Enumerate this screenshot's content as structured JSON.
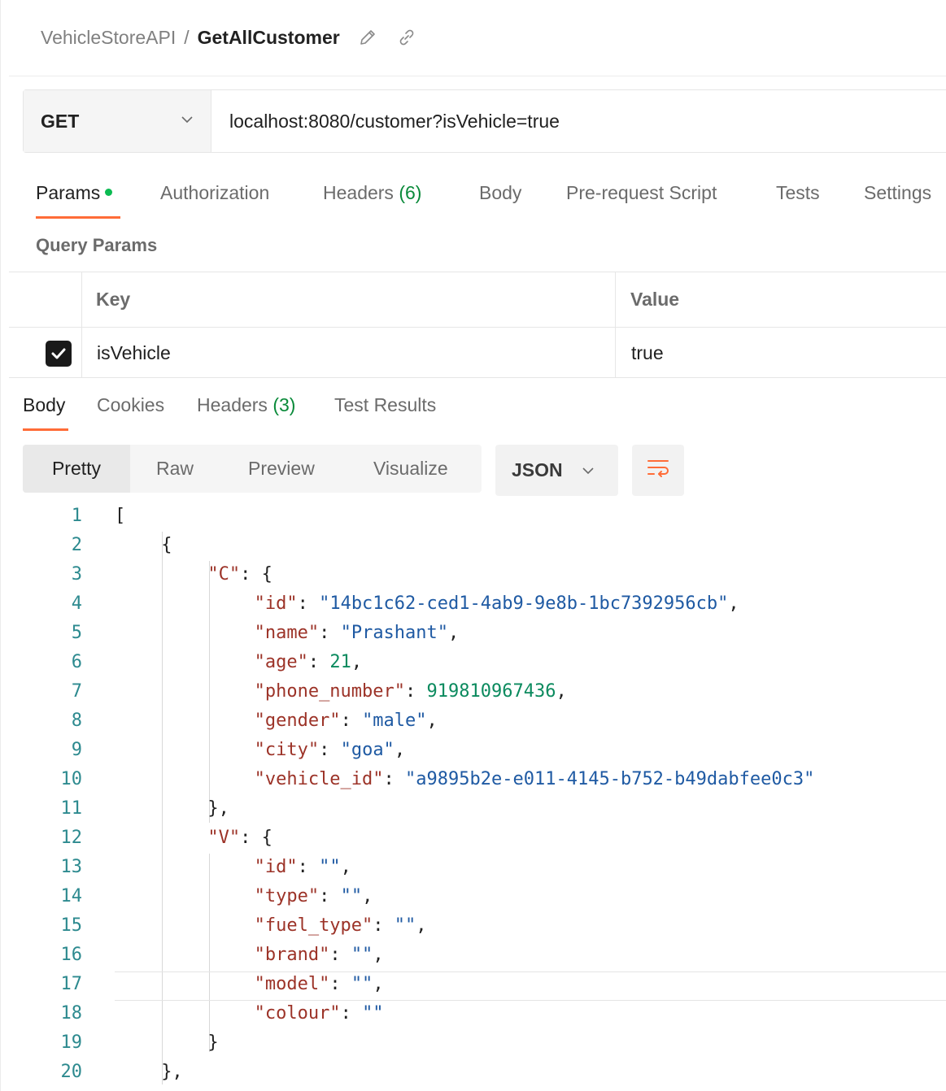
{
  "breadcrumb": {
    "collection": "VehicleStoreAPI",
    "separator": "/",
    "request": "GetAllCustomer"
  },
  "header_icons": [
    "pencil-icon",
    "link-icon"
  ],
  "request": {
    "method": "GET",
    "url": "localhost:8080/customer?isVehicle=true"
  },
  "request_tabs": {
    "params": "Params",
    "authorization": "Authorization",
    "headers": "Headers",
    "headers_count": "(6)",
    "body": "Body",
    "prerequest": "Pre-request Script",
    "tests": "Tests",
    "settings": "Settings"
  },
  "query_params": {
    "title": "Query Params",
    "key_header": "Key",
    "value_header": "Value",
    "rows": [
      {
        "checked": true,
        "key": "isVehicle",
        "value": "true"
      }
    ]
  },
  "response_tabs": {
    "body": "Body",
    "cookies": "Cookies",
    "headers": "Headers",
    "headers_count": "(3)",
    "test_results": "Test Results"
  },
  "view_modes": [
    "Pretty",
    "Raw",
    "Preview",
    "Visualize"
  ],
  "active_view": "Pretty",
  "format": "JSON",
  "colors": {
    "accent": "#ff6c37",
    "active_dot": "#0cbb52",
    "key": "#9c3328",
    "string": "#1f5aa3",
    "number": "#0b8a5e",
    "line_number": "#2d8a8f"
  },
  "code_lines": [
    {
      "n": "1",
      "indent": 0,
      "tokens": [
        [
          "p",
          "["
        ]
      ]
    },
    {
      "n": "2",
      "indent": 1,
      "tokens": [
        [
          "p",
          "{"
        ]
      ]
    },
    {
      "n": "3",
      "indent": 2,
      "tokens": [
        [
          "k",
          "\"C\""
        ],
        [
          "p",
          ": {"
        ]
      ]
    },
    {
      "n": "4",
      "indent": 3,
      "tokens": [
        [
          "k",
          "\"id\""
        ],
        [
          "p",
          ": "
        ],
        [
          "s",
          "\"14bc1c62-ced1-4ab9-9e8b-1bc7392956cb\""
        ],
        [
          "p",
          ","
        ]
      ]
    },
    {
      "n": "5",
      "indent": 3,
      "tokens": [
        [
          "k",
          "\"name\""
        ],
        [
          "p",
          ": "
        ],
        [
          "s",
          "\"Prashant\""
        ],
        [
          "p",
          ","
        ]
      ]
    },
    {
      "n": "6",
      "indent": 3,
      "tokens": [
        [
          "k",
          "\"age\""
        ],
        [
          "p",
          ": "
        ],
        [
          "n",
          "21"
        ],
        [
          "p",
          ","
        ]
      ]
    },
    {
      "n": "7",
      "indent": 3,
      "tokens": [
        [
          "k",
          "\"phone_number\""
        ],
        [
          "p",
          ": "
        ],
        [
          "n",
          "919810967436"
        ],
        [
          "p",
          ","
        ]
      ]
    },
    {
      "n": "8",
      "indent": 3,
      "tokens": [
        [
          "k",
          "\"gender\""
        ],
        [
          "p",
          ": "
        ],
        [
          "s",
          "\"male\""
        ],
        [
          "p",
          ","
        ]
      ]
    },
    {
      "n": "9",
      "indent": 3,
      "tokens": [
        [
          "k",
          "\"city\""
        ],
        [
          "p",
          ": "
        ],
        [
          "s",
          "\"goa\""
        ],
        [
          "p",
          ","
        ]
      ]
    },
    {
      "n": "10",
      "indent": 3,
      "tokens": [
        [
          "k",
          "\"vehicle_id\""
        ],
        [
          "p",
          ": "
        ],
        [
          "s",
          "\"a9895b2e-e011-4145-b752-b49dabfee0c3\""
        ]
      ]
    },
    {
      "n": "11",
      "indent": 2,
      "tokens": [
        [
          "p",
          "},"
        ]
      ]
    },
    {
      "n": "12",
      "indent": 2,
      "tokens": [
        [
          "k",
          "\"V\""
        ],
        [
          "p",
          ": {"
        ]
      ]
    },
    {
      "n": "13",
      "indent": 3,
      "tokens": [
        [
          "k",
          "\"id\""
        ],
        [
          "p",
          ": "
        ],
        [
          "s",
          "\"\""
        ],
        [
          "p",
          ","
        ]
      ]
    },
    {
      "n": "14",
      "indent": 3,
      "tokens": [
        [
          "k",
          "\"type\""
        ],
        [
          "p",
          ": "
        ],
        [
          "s",
          "\"\""
        ],
        [
          "p",
          ","
        ]
      ]
    },
    {
      "n": "15",
      "indent": 3,
      "tokens": [
        [
          "k",
          "\"fuel_type\""
        ],
        [
          "p",
          ": "
        ],
        [
          "s",
          "\"\""
        ],
        [
          "p",
          ","
        ]
      ]
    },
    {
      "n": "16",
      "indent": 3,
      "tokens": [
        [
          "k",
          "\"brand\""
        ],
        [
          "p",
          ": "
        ],
        [
          "s",
          "\"\""
        ],
        [
          "p",
          ","
        ]
      ]
    },
    {
      "n": "17",
      "indent": 3,
      "tokens": [
        [
          "k",
          "\"model\""
        ],
        [
          "p",
          ": "
        ],
        [
          "s",
          "\"\""
        ],
        [
          "p",
          ","
        ]
      ]
    },
    {
      "n": "18",
      "indent": 3,
      "tokens": [
        [
          "k",
          "\"colour\""
        ],
        [
          "p",
          ": "
        ],
        [
          "s",
          "\"\""
        ]
      ]
    },
    {
      "n": "19",
      "indent": 2,
      "tokens": [
        [
          "p",
          "}"
        ]
      ]
    },
    {
      "n": "20",
      "indent": 1,
      "tokens": [
        [
          "p",
          "},"
        ]
      ]
    }
  ]
}
